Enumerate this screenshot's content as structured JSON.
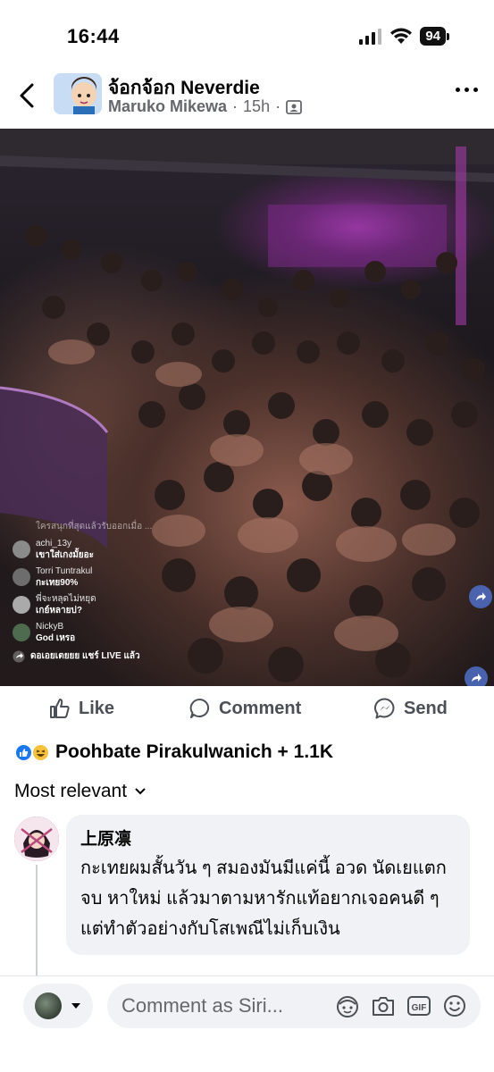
{
  "status": {
    "time": "16:44",
    "battery": "94"
  },
  "post": {
    "page_name": "จ้อกจ้อก Neverdie",
    "author": "Maruko Mikewa",
    "dot": "·",
    "time": "15h"
  },
  "video": {
    "live_comments": [
      {
        "name": "",
        "text": "ใครสนุกที่สุดแล้วรับออกเมื่อ ...",
        "faded": true
      },
      {
        "name": "achi_13y",
        "text": "เขาใส่เกงมั้ยอะ"
      },
      {
        "name": "Torri Tuntrakul",
        "text": "กะเทย90%"
      },
      {
        "name": "",
        "text": "พี่จะหลุดไม่หยุด",
        "sub": "เกย์หลายบ่?"
      },
      {
        "name": "NickyB",
        "text": "God เหรอ"
      }
    ],
    "share_line": "ดอเอยเตยยย แชร์ LIVE แล้ว"
  },
  "actions": {
    "like": "Like",
    "comment": "Comment",
    "send": "Send"
  },
  "reactions": {
    "summary": "Poohbate Pirakulwanich + 1.1K"
  },
  "sort": {
    "label": "Most relevant"
  },
  "comment": {
    "author": "上原凛",
    "text": "กะเทยผมสั้นวัน ๆ สมองมันมีแค่นี้ อวด นัดเยแตก จบ หาใหม่ แล้วมาตามหารักแท้อยากเจอคนดี ๆ แต่ทำตัวอย่างกับโสเพณีไม่เก็บเงิน"
  },
  "composer": {
    "placeholder": "Comment as Siri..."
  },
  "colors": {
    "brand": "#1877f2",
    "bubble": "#f0f2f5",
    "muted": "#65676b"
  }
}
